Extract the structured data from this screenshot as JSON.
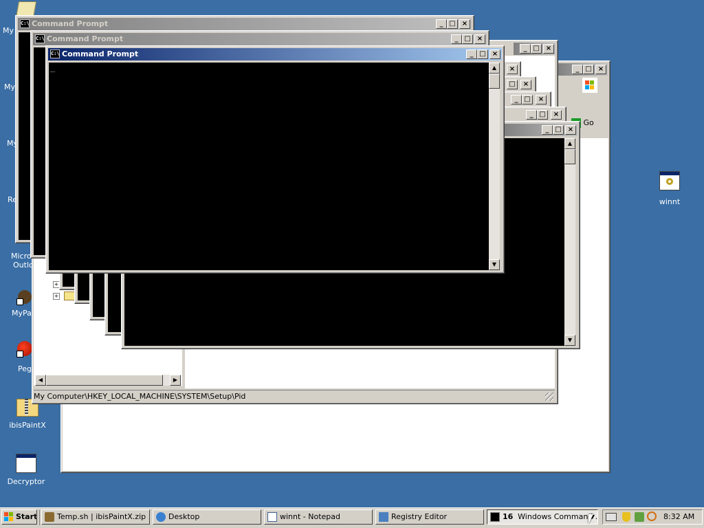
{
  "windows": {
    "cmd_title": "Command Prompt",
    "cmd_icon": "C:\\",
    "status_path": "My Computer\\HKEY_LOCAL_MACHINE\\SYSTEM\\Setup\\Pid",
    "go_label": "Go",
    "cursor": "_"
  },
  "desktop_icons": [
    {
      "label": "My",
      "icon": "my-documents-icon"
    },
    {
      "label": "My",
      "icon": "my-computer-icon"
    },
    {
      "label": "My",
      "icon": "my-network-places-icon"
    },
    {
      "label": "Re",
      "icon": "recycle-bin-icon"
    },
    {
      "label": "Micro",
      "label2": "Outlo",
      "icon": "outlook-icon"
    },
    {
      "label": "MyPa",
      "icon": "mypaint-icon"
    },
    {
      "label": "Peg",
      "icon": "pegasus-icon"
    },
    {
      "label": "ibisPaintX",
      "icon": "zip-folder-icon"
    },
    {
      "label": "Decryptor",
      "icon": "application-icon"
    },
    {
      "label": "winnt",
      "icon": "settings-file-icon"
    }
  ],
  "taskbar": {
    "start_label": "Start",
    "items": [
      {
        "label": "Temp.sh | ibisPaintX.zip ..."
      },
      {
        "label": "Desktop"
      },
      {
        "label": "winnt - Notepad"
      },
      {
        "label": "Registry Editor"
      },
      {
        "count": "16",
        "label": "Windows Command ..."
      }
    ],
    "clock": "8:32 AM"
  },
  "colors": {
    "desktop": "#3a6ea5",
    "active_title": "#0a246a",
    "inactive_title": "#808080",
    "console_bg": "#000000"
  }
}
